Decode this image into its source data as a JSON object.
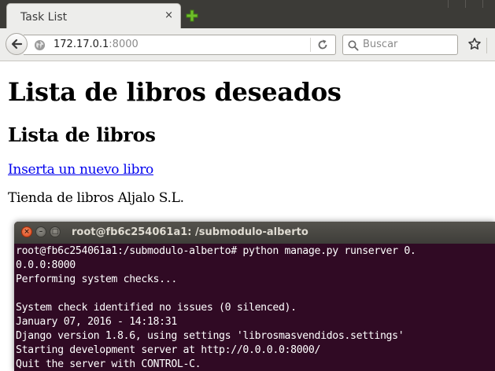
{
  "browser": {
    "tab": {
      "title": "Task List",
      "close_glyph": "×"
    },
    "url": {
      "host": "172.17.0.1",
      "port": ":8000"
    },
    "search": {
      "placeholder": "Buscar"
    },
    "colors": {
      "chrome": "#ededeb",
      "tabbar": "#3c3b37",
      "newtab": "#6fbf2a"
    },
    "icons": [
      "back-arrow-icon",
      "globe-icon",
      "reload-icon",
      "search-icon",
      "bookmark-star-icon",
      "close-icon",
      "new-tab-plus-icon"
    ]
  },
  "page": {
    "title": "Lista de libros deseados",
    "subtitle": "Lista de libros",
    "link": "Inserta un nuevo libro",
    "footer": "Tienda de libros Aljalo S.L.",
    "colors": {
      "link": "#0000ee",
      "text": "#000000"
    }
  },
  "terminal": {
    "title": "root@fb6c254061a1: /submodulo-alberto",
    "buttons": {
      "close": "×",
      "minimize": "–",
      "maximize": "□"
    },
    "lines": [
      "root@fb6c254061a1:/submodulo-alberto# python manage.py runserver 0.",
      "0.0.0:8000",
      "Performing system checks...",
      "",
      "System check identified no issues (0 silenced).",
      "January 07, 2016 - 14:18:31",
      "Django version 1.8.6, using settings 'librosmasvendidos.settings'",
      "Starting development server at http://0.0.0.0:8000/",
      "Quit the server with CONTROL-C."
    ],
    "colors": {
      "background": "#300a24",
      "text": "#ffffff"
    }
  }
}
